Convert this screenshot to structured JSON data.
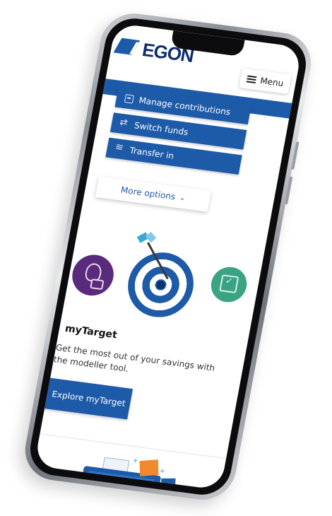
{
  "brand": {
    "logo_text": "AEGON",
    "logo_first": "A",
    "logo_rest": "EGON",
    "accent": "#1d5aa8",
    "navy": "#0f2d6b"
  },
  "header": {
    "menu_label": "Menu"
  },
  "actions": [
    {
      "label": "Manage contributions",
      "icon": "calendar-icon"
    },
    {
      "label": "Switch funds",
      "icon": "switch-arrows-icon"
    },
    {
      "label": "Transfer in",
      "icon": "coins-icon"
    }
  ],
  "more_options": {
    "label": "More options",
    "icon": "chevron-down-icon"
  },
  "illustration": {
    "left_icon": "money-bag-icon",
    "center_icon": "target-icon",
    "right_icon": "calendar-clock-icon",
    "colors": {
      "purple": "#5a2a7d",
      "green": "#3aa384"
    }
  },
  "mytarget": {
    "title": "myTarget",
    "description": "Get the most out of your savings with the modeller tool.",
    "cta_label": "Explore myTarget"
  }
}
